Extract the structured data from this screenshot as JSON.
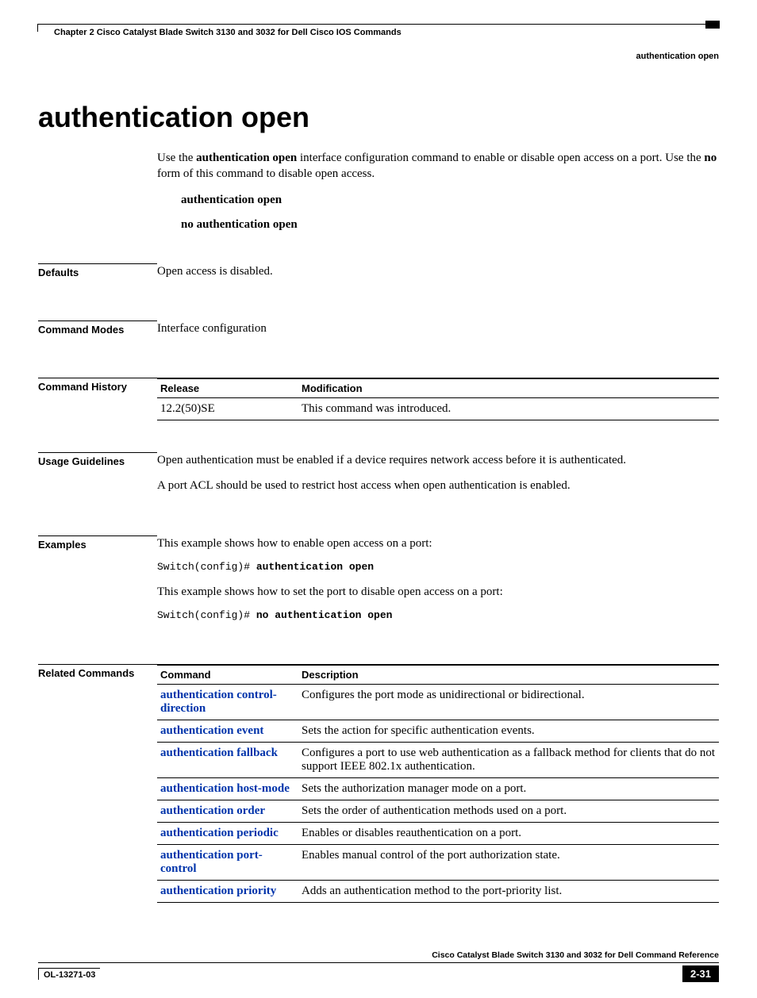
{
  "header": {
    "chapter_line": "Chapter 2      Cisco Catalyst Blade Switch 3130 and 3032 for Dell Cisco IOS Commands",
    "topic": "authentication open"
  },
  "title": "authentication open",
  "intro": {
    "p1_pre": "Use the ",
    "p1_b1": "authentication open",
    "p1_mid": " interface configuration command to enable or disable open access on a port. Use the ",
    "p1_b2": "no",
    "p1_post": " form of this command to disable open access."
  },
  "syntax": {
    "line1": "authentication open",
    "line2": "no authentication open"
  },
  "sections": {
    "defaults_label": "Defaults",
    "defaults_text": "Open access is disabled.",
    "modes_label": "Command Modes",
    "modes_text": "Interface configuration",
    "history_label": "Command History",
    "usage_label": "Usage Guidelines",
    "examples_label": "Examples",
    "related_label": "Related Commands"
  },
  "history": {
    "h_release": "Release",
    "h_mod": "Modification",
    "rows": [
      {
        "release": "12.2(50)SE",
        "mod": "This command was introduced."
      }
    ]
  },
  "usage": {
    "p1": "Open authentication must be enabled if a device requires network access before it is authenticated.",
    "p2": "A port ACL should be used to restrict host access when open authentication is enabled."
  },
  "examples": {
    "p1": "This example shows how to enable open access on a port:",
    "c1_prompt": "Switch(config)# ",
    "c1_cmd": "authentication open",
    "p2": "This example shows how to set the port to disable open access on a port:",
    "c2_prompt": "Switch(config)# ",
    "c2_cmd": "no authentication open"
  },
  "related": {
    "h_cmd": "Command",
    "h_desc": "Description",
    "rows": [
      {
        "cmd": "authentication control-direction",
        "desc": "Configures the port mode as unidirectional or bidirectional."
      },
      {
        "cmd": "authentication event",
        "desc": "Sets the action for specific authentication events."
      },
      {
        "cmd": "authentication fallback",
        "desc": "Configures a port to use web authentication as a fallback method for clients that do not support IEEE 802.1x authentication."
      },
      {
        "cmd": "authentication host-mode",
        "desc": "Sets the authorization manager mode on a port."
      },
      {
        "cmd": "authentication order",
        "desc": "Sets the order of authentication methods used on a port."
      },
      {
        "cmd": "authentication periodic",
        "desc": "Enables or disables reauthentication on a port."
      },
      {
        "cmd": "authentication port-control",
        "desc": "Enables manual control of the port authorization state."
      },
      {
        "cmd": "authentication priority",
        "desc": "Adds an authentication method to the port-priority list."
      }
    ]
  },
  "footer": {
    "book": "Cisco Catalyst Blade Switch 3130 and 3032 for Dell Command Reference",
    "ol": "OL-13271-03",
    "page": "2-31"
  }
}
